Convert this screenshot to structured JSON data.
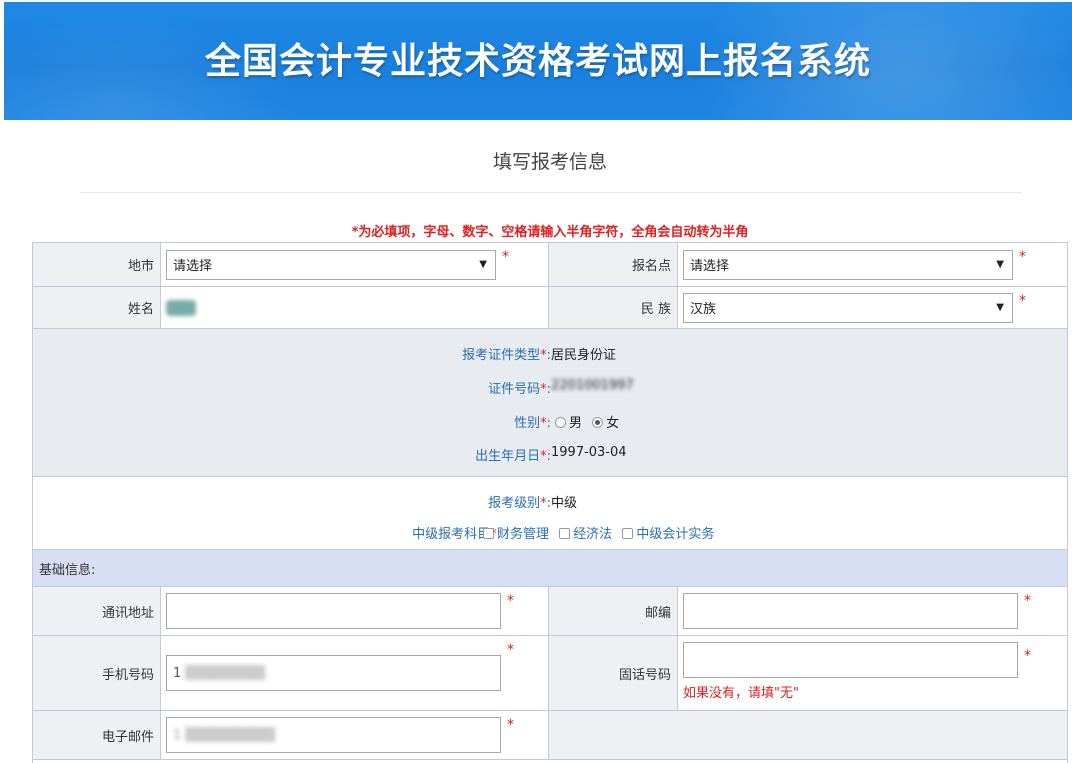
{
  "banner": {
    "title": "全国会计专业技术资格考试网上报名系统"
  },
  "page": {
    "title": "填写报考信息",
    "notice": "*为必填项，字母、数字、空格请输入半角字符，全角会自动转为半角"
  },
  "required_mark": "*",
  "top_rows": {
    "city": {
      "label": "地市",
      "value": "请选择",
      "arrow": "▼"
    },
    "site": {
      "label": "报名点",
      "value": "请选择",
      "arrow": "▼"
    },
    "name": {
      "label": "姓名"
    },
    "ethnicity": {
      "label": "民 族",
      "value": "汉族",
      "arrow": "▼"
    }
  },
  "identity": {
    "id_type": {
      "label": "报考证件类型",
      "value": "居民身份证"
    },
    "id_number": {
      "label": "证件号码",
      "value": "2201001997"
    },
    "gender": {
      "label": "性别",
      "options": [
        "男",
        "女"
      ],
      "selected": "女"
    },
    "birth": {
      "label": "出生年月日",
      "value": "1997-03-04"
    }
  },
  "level": {
    "level": {
      "label": "报考级别",
      "value": "中级"
    },
    "subjects": {
      "label": "中级报考科目",
      "options": [
        "财务管理",
        "经济法",
        "中级会计实务"
      ]
    }
  },
  "basic": {
    "section_title": "基础信息:",
    "address": {
      "label": "通讯地址",
      "value": ""
    },
    "postcode": {
      "label": "邮编",
      "value": ""
    },
    "mobile": {
      "label": "手机号码",
      "value": "1"
    },
    "phone": {
      "label": "固话号码",
      "value": "",
      "hint": "如果没有，请填\"无\""
    },
    "email": {
      "label": "电子邮件",
      "value": "1"
    }
  },
  "colors": {
    "banner": "#1a7fdc",
    "required": "#e02020",
    "field_label": "#2a6fb3",
    "section_header": "#d7dff5",
    "id_block_bg": "#e8ebf0"
  }
}
